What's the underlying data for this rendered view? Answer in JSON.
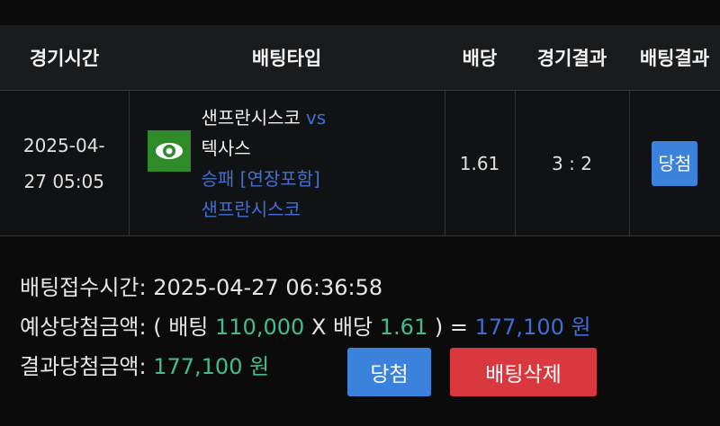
{
  "table": {
    "headers": {
      "time": "경기시간",
      "bet_type": "배팅타입",
      "odds": "배당",
      "game_result": "경기결과",
      "bet_result": "배팅결과"
    },
    "row": {
      "date": "2025-04-",
      "time": "27 05:05",
      "team_home": "샌프란시스코",
      "vs": "vs",
      "team_away": "텍사스",
      "market": "승패 [연장포함]",
      "pick": "샌프란시스코",
      "odds": "1.61",
      "score": "3 : 2",
      "status": "당첨",
      "icon": "eye-icon"
    }
  },
  "info": {
    "accepted_label": "배팅접수시간:",
    "accepted_value": "2025-04-27 06:36:58",
    "expected_label": "예상당첨금액:",
    "open_paren": "( 배팅",
    "stake": "110,000",
    "times": "X 배당",
    "odds": "1.61",
    "close_eq": ") =",
    "expected_amount": "177,100 원",
    "result_label": "결과당첨금액:",
    "result_amount": "177,100 원"
  },
  "buttons": {
    "win": "당첨",
    "delete": "배팅삭제"
  },
  "colors": {
    "background": "#0b0b0b",
    "header": "#1a1b1c",
    "accent_blue": "#3b82dd",
    "link_blue": "#3f6fd6",
    "green": "#3fbf8f",
    "danger": "#d9393e",
    "icon_green": "#2f8a2a"
  }
}
